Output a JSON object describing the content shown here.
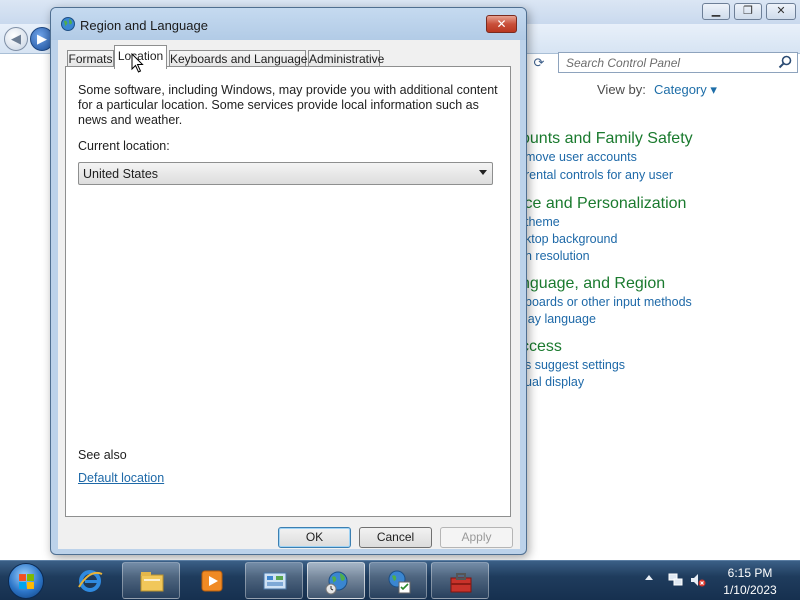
{
  "control_panel": {
    "window_buttons": {
      "minimize": "▁",
      "maximize": "❐",
      "close": "✕"
    },
    "nav": {
      "back_icon": "back-arrow-icon",
      "forward_icon": "forward-arrow-icon",
      "refresh_icon": "refresh-icon"
    },
    "search": {
      "placeholder": "Search Control Panel",
      "icon": "search-icon"
    },
    "view_by": {
      "label": "View by:",
      "value": "Category"
    },
    "categories": [
      {
        "heading": "ounts and Family Safety",
        "links": [
          "move user accounts",
          "rental controls for any user"
        ]
      },
      {
        "heading": "ice and Personalization",
        "links": [
          "theme",
          "ktop background",
          "n resolution"
        ]
      },
      {
        "heading": "nguage, and Region",
        "links": [
          "boards or other input methods",
          "lay language"
        ]
      },
      {
        "heading": "ccess",
        "links": [
          "s suggest settings",
          "ual display"
        ]
      }
    ]
  },
  "dialog": {
    "title": "Region and Language",
    "close_label": "✕",
    "tabs": [
      {
        "label": "Formats",
        "active": false
      },
      {
        "label": "Location",
        "active": true
      },
      {
        "label": "Keyboards and Languages",
        "active": false
      },
      {
        "label": "Administrative",
        "active": false
      }
    ],
    "location_tab": {
      "description": "Some software, including Windows, may provide you with additional content for a particular location. Some services provide local information such as news and weather.",
      "current_location_label": "Current location:",
      "current_location_value": "United States",
      "see_also_label": "See also",
      "default_location_link": "Default location"
    },
    "buttons": {
      "ok": "OK",
      "cancel": "Cancel",
      "apply": "Apply"
    }
  },
  "taskbar": {
    "pinned_items": [
      "internet-explorer-icon",
      "windows-explorer-icon",
      "media-player-icon",
      "control-panel-icon",
      "region-language-globe-icon",
      "region-settings-icon",
      "toolbox-icon"
    ],
    "clock": {
      "time": "6:15 PM",
      "date": "1/10/2023"
    },
    "tray_icons": [
      "show-hidden-icons-arrow",
      "network-icon",
      "volume-muted-icon"
    ]
  },
  "colors": {
    "link": "#1e69a8",
    "category_heading": "#1a7a2e",
    "dialog_frame": "#bcd2ea",
    "close_button": "#c9503a",
    "taskbar": "#1f3c5d"
  }
}
